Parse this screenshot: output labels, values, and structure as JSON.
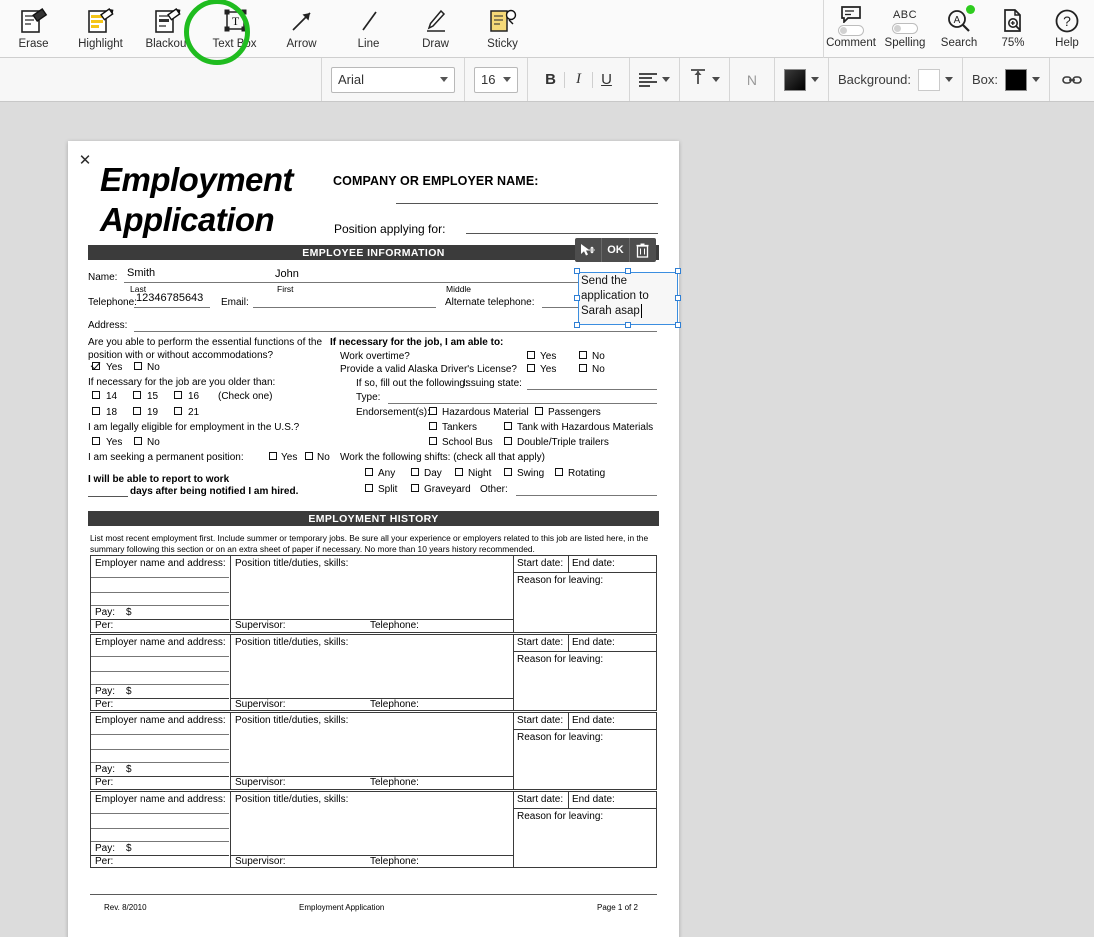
{
  "toolbar": {
    "tools": [
      {
        "label": "Erase",
        "icon": "eraser-icon",
        "active": false
      },
      {
        "label": "Highlight",
        "icon": "highlighter-icon",
        "active": false
      },
      {
        "label": "Blackout",
        "icon": "blackout-icon",
        "active": false
      },
      {
        "label": "Text Box",
        "icon": "text-box-icon",
        "active": true
      },
      {
        "label": "Arrow",
        "icon": "arrow-icon",
        "active": false
      },
      {
        "label": "Line",
        "icon": "line-icon",
        "active": false
      },
      {
        "label": "Draw",
        "icon": "draw-icon",
        "active": false
      },
      {
        "label": "Sticky",
        "icon": "sticky-note-icon",
        "active": false
      }
    ],
    "right": [
      {
        "label": "Comment",
        "icon": "comment-icon"
      },
      {
        "label": "Spelling",
        "icon": "spelling-abc-icon",
        "badge_text": "ABC"
      },
      {
        "label": "Search",
        "icon": "search-icon"
      },
      {
        "label": "75%",
        "icon": "zoom-page-icon"
      },
      {
        "label": "Help",
        "icon": "help-icon"
      }
    ],
    "highlight_color": "#1fbc1f",
    "search_badge_color": "#2ecc1f"
  },
  "format_bar": {
    "font_family": "Arial",
    "font_size": "16",
    "bold_label": "B",
    "italic_label": "I",
    "underline_label": "U",
    "align_icon": "align-left-icon",
    "line_spacing_icon": "line-spacing-icon",
    "numbering_label": "N",
    "text_color": "#1a1a1a",
    "background_label": "Background:",
    "background_color": "#ffffff",
    "box_label": "Box:",
    "box_color": "#000000",
    "link_icon": "link-icon"
  },
  "annotation": {
    "mini_toolbar": {
      "move_label": "↖",
      "ok_label": "OK",
      "delete_label": "🗑"
    },
    "text_box_value": "Send the\napplication to\nSarah asap",
    "selected": true,
    "selection_color": "#3b8ee0"
  },
  "document": {
    "close_label": "✕",
    "title": "Employment\nApplication",
    "company_label": "COMPANY OR EMPLOYER NAME:",
    "position_label": "Position applying for:",
    "section_employee": "EMPLOYEE INFORMATION",
    "section_history": "EMPLOYMENT HISTORY",
    "fields": {
      "name_label": "Name:",
      "name_last_value": "Smith",
      "name_first_value": "John",
      "last_label": "Last",
      "first_label": "First",
      "middle_label": "Middle",
      "telephone_label": "Telephone:",
      "telephone_value": "12346785643",
      "email_label": "Email:",
      "alt_telephone_label": "Alternate telephone:",
      "address_label": "Address:"
    },
    "left_column": {
      "q_essential": "Are you able to perform the essential functions of",
      "q_essential2": "the position with or without accommodations?",
      "q_essential_yes": "Yes",
      "q_essential_no": "No",
      "q_essential_yes_checked": true,
      "q_older": "If necessary for the job are you older than:",
      "ages_row1": [
        "14",
        "15",
        "16"
      ],
      "check_one_note": "(Check one)",
      "ages_row2": [
        "18",
        "19",
        "21"
      ],
      "q_eligible": "I am legally eligible for employment in the U.S.?",
      "q_eligible_yes": "Yes",
      "q_eligible_no": "No",
      "q_permanent": "I am seeking a permanent position:",
      "q_permanent_yes": "Yes",
      "q_permanent_no": "No",
      "report_line1": "I will be able to report to work",
      "report_line2": "days after being notified I am hired."
    },
    "right_column": {
      "heading": "If necessary for the job, I am able to:",
      "overtime_label": "Work overtime?",
      "overtime_yes": "Yes",
      "overtime_no": "No",
      "license_label": "Provide a valid Alaska Driver's License?",
      "license_yes": "Yes",
      "license_no": "No",
      "if_so_label": "If so, fill out the following:",
      "issuing_state_label": "Issuing state:",
      "type_label": "Type:",
      "endorsements_label": "Endorsement(s):",
      "endorsements": [
        "Hazardous Material",
        "Passengers",
        "Tankers",
        "Tank with Hazardous Materials",
        "School Bus",
        "Double/Triple trailers"
      ],
      "shifts_label": "Work the following shifts: (check all that apply)",
      "shifts_row1": [
        "Any",
        "Day",
        "Night",
        "Swing",
        "Rotating"
      ],
      "shifts_row2": [
        "Split",
        "Graveyard"
      ],
      "other_label": "Other:"
    },
    "history_intro_line1": "List most recent employment first. Include summer or temporary jobs. Be sure all your experience or employers related to this job are listed",
    "history_intro_line2": "here, in the summary following this section or on an extra sheet of paper if necessary. No more than 10 years history recommended.",
    "history_headers": {
      "employer": "Employer name and address:",
      "position": "Position title/duties, skills:",
      "start_date": "Start date:",
      "end_date": "End date:",
      "reason": "Reason for leaving:",
      "pay": "Pay:",
      "pay_currency": "$",
      "per": "Per:",
      "supervisor": "Supervisor:",
      "telephone": "Telephone:"
    },
    "history_row_count": 4,
    "footer": {
      "revision": "Rev. 8/2010",
      "center": "Employment Application",
      "page": "Page 1 of 2"
    }
  }
}
